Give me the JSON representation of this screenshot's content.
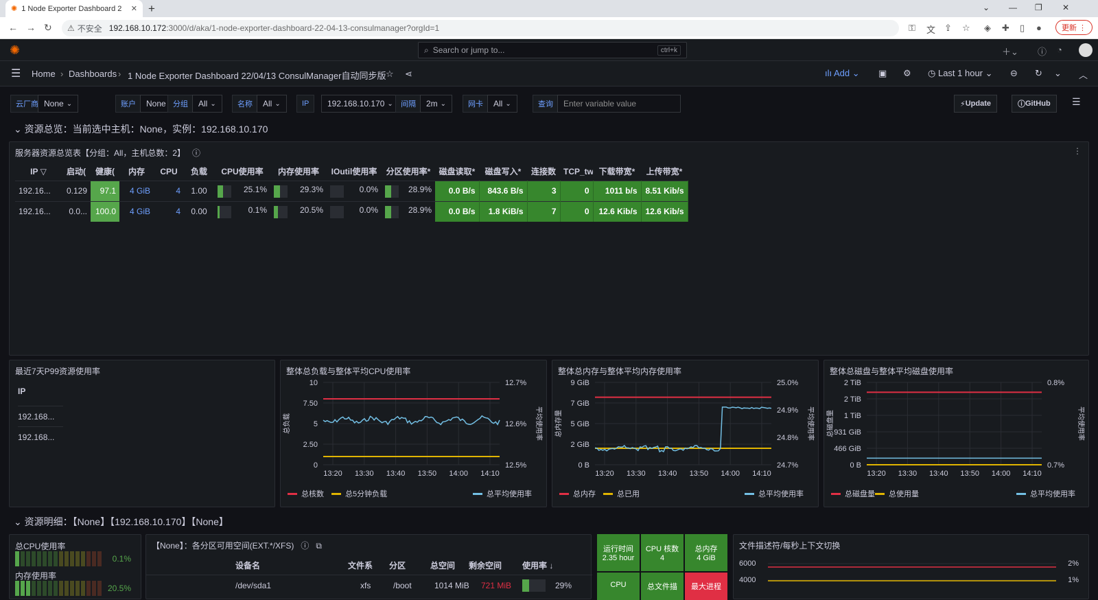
{
  "browser": {
    "tab_title": "1 Node Exporter Dashboard 2",
    "url_warn": "不安全",
    "url_host": "192.168.10.172",
    "url_path": ":3000/d/aka/1-node-exporter-dashboard-22-04-13-consulmanager?orgId=1",
    "update_label": "更新"
  },
  "topbar": {
    "search_placeholder": "Search or jump to...",
    "search_kbd": "ctrl+k"
  },
  "breadcrumb": {
    "home": "Home",
    "dashboards": "Dashboards",
    "title": "1 Node Exporter Dashboard 22/04/13 ConsulManager自动同步版"
  },
  "navbar": {
    "add": "Add",
    "time_range": "Last 1 hour"
  },
  "variables": [
    {
      "label": "云厂商",
      "value": "None"
    },
    {
      "label": "账户",
      "value": "None"
    },
    {
      "label": "分组",
      "value": "All"
    },
    {
      "label": "名称",
      "value": "All"
    },
    {
      "label": "IP",
      "value": "192.168.10.170"
    },
    {
      "label": "间隔",
      "value": "2m"
    },
    {
      "label": "网卡",
      "value": "All"
    }
  ],
  "query": {
    "label": "查询",
    "placeholder": "Enter variable value"
  },
  "buttons": {
    "update": "Update",
    "github": "GitHub"
  },
  "row1_title": "资源总览：当前选中主机：None，实例：192.168.10.170",
  "overview": {
    "title": "服务器资源总览表【分组：All，主机总数：2】",
    "headers": [
      "IP",
      "启动(",
      "健康(",
      "内存",
      "CPU",
      "负载",
      "CPU使用率",
      "内存使用率",
      "IOutil使用率",
      "分区使用率*",
      "磁盘读取*",
      "磁盘写入*",
      "连接数",
      "TCP_tw",
      "下载带宽*",
      "上传带宽*"
    ],
    "rows": [
      {
        "ip": "192.16...",
        "uptime": "0.129",
        "health": "97.1",
        "mem": "4 GiB",
        "cpu": "4",
        "load": "1.00",
        "cpu_use": "25.1%",
        "cpu_pct": 25.1,
        "mem_use": "29.3%",
        "mem_pct": 29.3,
        "io": "0.0%",
        "io_pct": 0,
        "part": "28.9%",
        "part_pct": 28.9,
        "read": "0.0 B/s",
        "write": "843.6 B/s",
        "conn": "3",
        "tcp": "0",
        "down": "1011 b/s",
        "up": "8.51 Kib/s"
      },
      {
        "ip": "192.16...",
        "uptime": "0.0...",
        "health": "100.0",
        "mem": "4 GiB",
        "cpu": "4",
        "load": "0.00",
        "cpu_use": "0.1%",
        "cpu_pct": 0.1,
        "mem_use": "20.5%",
        "mem_pct": 20.5,
        "io": "0.0%",
        "io_pct": 0,
        "part": "28.9%",
        "part_pct": 28.9,
        "read": "0.0 B/s",
        "write": "1.8 KiB/s",
        "conn": "7",
        "tcp": "0",
        "down": "12.6 Kib/s",
        "up": "12.6 Kib/s"
      }
    ]
  },
  "p99": {
    "title": "最近7天P99资源使用率",
    "header": "IP",
    "rows": [
      "192.168...",
      "192.168..."
    ]
  },
  "charts": {
    "c1": {
      "title": "整体总负载与整体平均CPU使用率",
      "yleft": [
        "10",
        "7.50",
        "5",
        "2.50",
        "0"
      ],
      "yright": [
        "12.7%",
        "12.6%",
        "12.5%"
      ],
      "xticks": [
        "13:20",
        "13:30",
        "13:40",
        "13:50",
        "14:00",
        "14:10"
      ],
      "ylabel": "总负载",
      "y2label": "平均使用率",
      "legend": [
        "总核数",
        "总5分钟负载",
        "总平均使用率"
      ]
    },
    "c2": {
      "title": "整体总内存与整体平均内存使用率",
      "yleft": [
        "9 GiB",
        "7 GiB",
        "5 GiB",
        "2 GiB",
        "0 B"
      ],
      "yright": [
        "25.0%",
        "24.9%",
        "24.8%",
        "24.7%"
      ],
      "xticks": [
        "13:20",
        "13:30",
        "13:40",
        "13:50",
        "14:00",
        "14:10"
      ],
      "ylabel": "总内存量",
      "y2label": "平均使用率",
      "legend": [
        "总内存",
        "总已用",
        "总平均使用率"
      ]
    },
    "c3": {
      "title": "整体总磁盘与整体平均磁盘使用率",
      "yleft": [
        "2 TiB",
        "2 TiB",
        "1 TiB",
        "931 GiB",
        "466 GiB",
        "0 B"
      ],
      "yright": [
        "0.8%",
        "0.7%"
      ],
      "xticks": [
        "13:20",
        "13:30",
        "13:40",
        "13:50",
        "14:00",
        "14:10"
      ],
      "ylabel": "总磁盘量",
      "y2label": "平均使用率",
      "legend": [
        "总磁盘量",
        "总使用量",
        "总平均使用率"
      ]
    }
  },
  "chart_data": [
    {
      "type": "line",
      "title": "整体总负载与整体平均CPU使用率",
      "x": [
        "13:20",
        "13:30",
        "13:40",
        "13:50",
        "14:00",
        "14:10"
      ],
      "series": [
        {
          "name": "总核数",
          "values": [
            8,
            8,
            8,
            8,
            8,
            8
          ]
        },
        {
          "name": "总5分钟负载",
          "values": [
            1,
            1,
            1,
            1,
            1,
            1
          ]
        },
        {
          "name": "总平均使用率",
          "values": [
            12.61,
            12.62,
            12.615,
            12.62,
            12.62,
            12.62
          ]
        }
      ],
      "ylim": [
        0,
        10
      ]
    },
    {
      "type": "line",
      "title": "整体总内存与整体平均内存使用率",
      "x": [
        "13:20",
        "13:30",
        "13:40",
        "13:50",
        "14:00",
        "14:10"
      ],
      "series": [
        {
          "name": "总内存",
          "values": [
            8,
            8,
            8,
            8,
            8,
            8
          ]
        },
        {
          "name": "总已用",
          "values": [
            2,
            2,
            2,
            2,
            2,
            2
          ]
        },
        {
          "name": "总平均使用率",
          "values": [
            24.74,
            24.76,
            24.73,
            24.74,
            24.9,
            24.9
          ]
        }
      ]
    },
    {
      "type": "line",
      "title": "整体总磁盘与整体平均磁盘使用率",
      "x": [
        "13:20",
        "13:30",
        "13:40",
        "13:50",
        "14:00",
        "14:10"
      ],
      "series": [
        {
          "name": "总磁盘量",
          "values": [
            2.2,
            2.2,
            2.2,
            2.2,
            2.2,
            2.2
          ]
        },
        {
          "name": "总使用量",
          "values": [
            0,
            0,
            0,
            0,
            0,
            0
          ]
        },
        {
          "name": "总平均使用率",
          "values": [
            0.7,
            0.7,
            0.7,
            0.7,
            0.7,
            0.7
          ]
        }
      ]
    }
  ],
  "row2_title": "资源明细：【None】【192.168.10.170】【None】",
  "detail": {
    "cpu_label": "总CPU使用率",
    "cpu_value": "0.1%",
    "mem_label": "内存使用率",
    "mem_value": "20.5%",
    "disk_title": "【None】：各分区可用空间(EXT.*/XFS)",
    "disk_headers": [
      "设备名",
      "文件系",
      "分区",
      "总空间",
      "剩余空间",
      "使用率 ↓"
    ],
    "disk_row": {
      "dev": "/dev/sda1",
      "fs": "xfs",
      "mount": "/boot",
      "total": "1014 MiB",
      "free": "721 MiB",
      "use": "29%"
    },
    "stats": [
      {
        "label": "运行时间",
        "value": "2.35 hour"
      },
      {
        "label": "CPU 核数",
        "value": "4"
      },
      {
        "label": "总内存",
        "value": "4 GiB"
      },
      {
        "label": "CPU",
        "value": ""
      },
      {
        "label": "总文件描",
        "value": ""
      },
      {
        "label": "最大进程",
        "value": ""
      }
    ],
    "fd_title": "文件描述符/每秒上下文切换",
    "fd_yleft": [
      "6000",
      "4000"
    ],
    "fd_yright": [
      "2%",
      "1%"
    ]
  },
  "colors": {
    "green": "#37872d",
    "light_green": "#56a64b",
    "red": "#e02f44",
    "yellow": "#e0b400",
    "cyan": "#73bfe4",
    "blue": "#6e9fff"
  }
}
